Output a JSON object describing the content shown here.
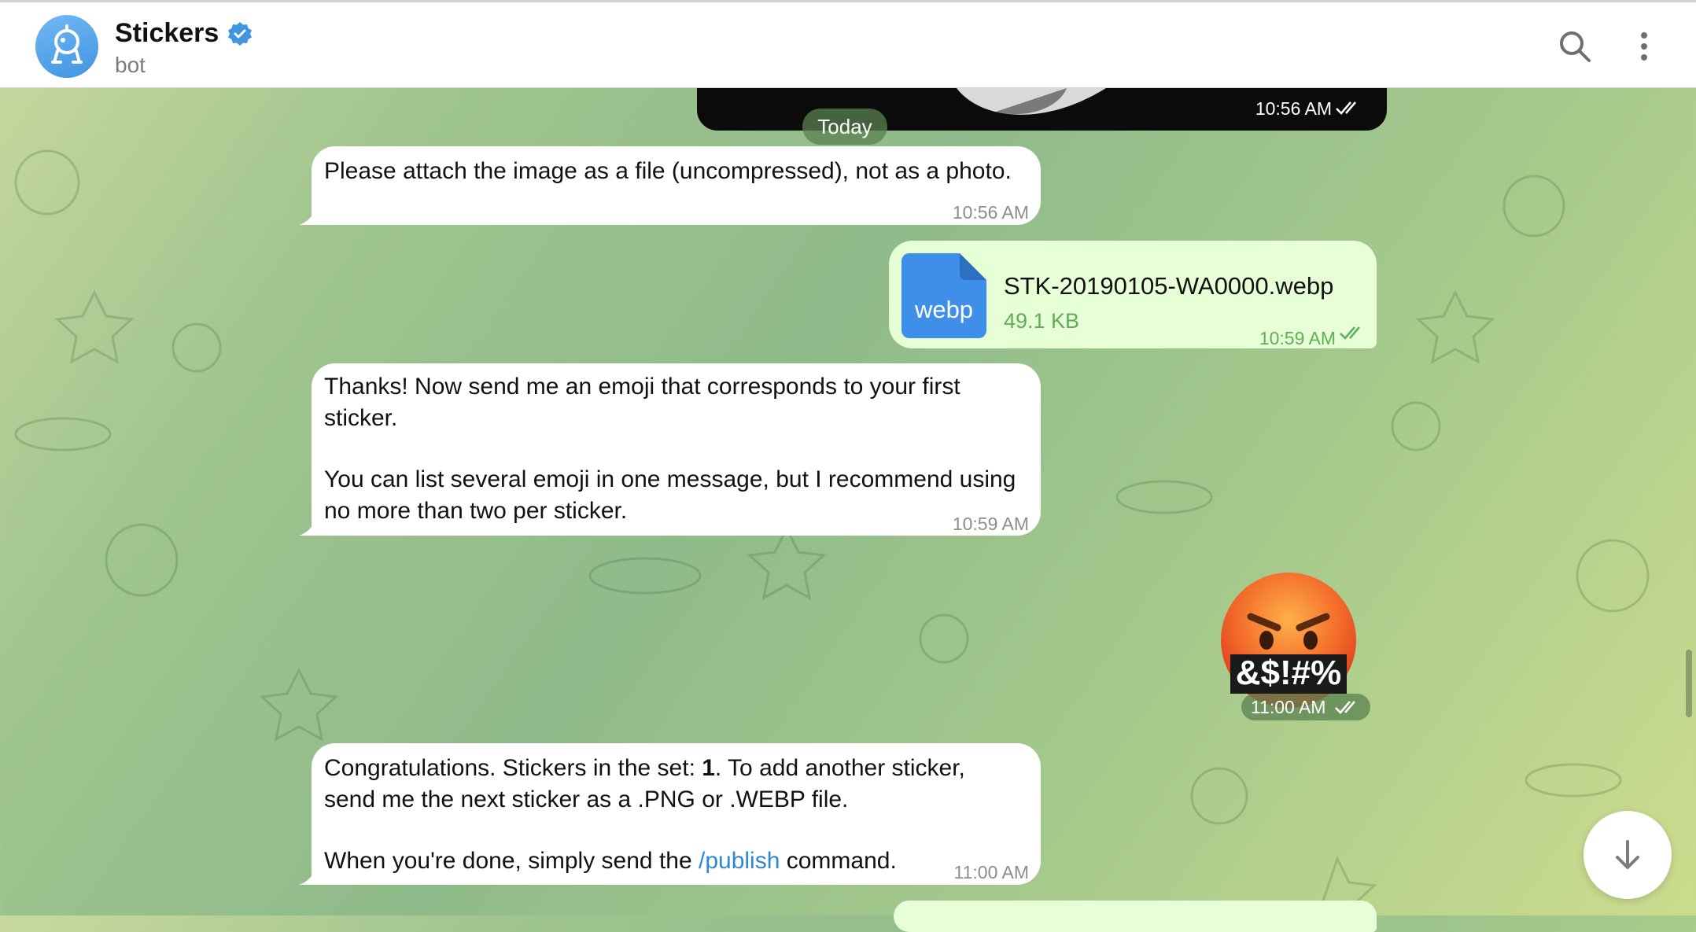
{
  "header": {
    "title": "Stickers",
    "subtitle": "bot",
    "icons": [
      "robot-avatar",
      "verified-badge-icon",
      "search-icon",
      "more-vertical-icon"
    ]
  },
  "top_media": {
    "time": "10:56 AM"
  },
  "date_separator": "Today",
  "messages": [
    {
      "type": "incoming",
      "text": "Please attach the image as a file (uncompressed), not as a photo.",
      "time": "10:56 AM"
    },
    {
      "type": "outgoing-file",
      "file_ext": "webp",
      "file_name": "STK-20190105-WA0000.webp",
      "file_size": "49.1 KB",
      "time": "10:59 AM"
    },
    {
      "type": "incoming",
      "line1": "Thanks! Now send me an emoji that corresponds to your first",
      "line2": "sticker.",
      "line3": "You can list several emoji in one message, but I recommend using",
      "line4": "no more than two per sticker.",
      "time": "10:59 AM"
    },
    {
      "type": "outgoing-sticker",
      "sticker_text": "&$!#%",
      "time": "11:00 AM"
    },
    {
      "type": "incoming",
      "line1_a": "Congratulations. Stickers in the set: ",
      "line1_bold": "1",
      "line1_b": ". To add another sticker,",
      "line2": "send me the next sticker as a .PNG or .WEBP file.",
      "line3_a": "When you're done, simply send the ",
      "line3_link": "/publish",
      "line3_b": " command.",
      "time": "11:00 AM"
    }
  ],
  "colors": {
    "header_bg": "#ffffff",
    "incoming_bubble": "#ffffff",
    "outgoing_bubble": "#e7ffd6",
    "accent_blue": "#3f95e0",
    "link": "#2f87d8",
    "outgoing_time": "#5fae57"
  }
}
